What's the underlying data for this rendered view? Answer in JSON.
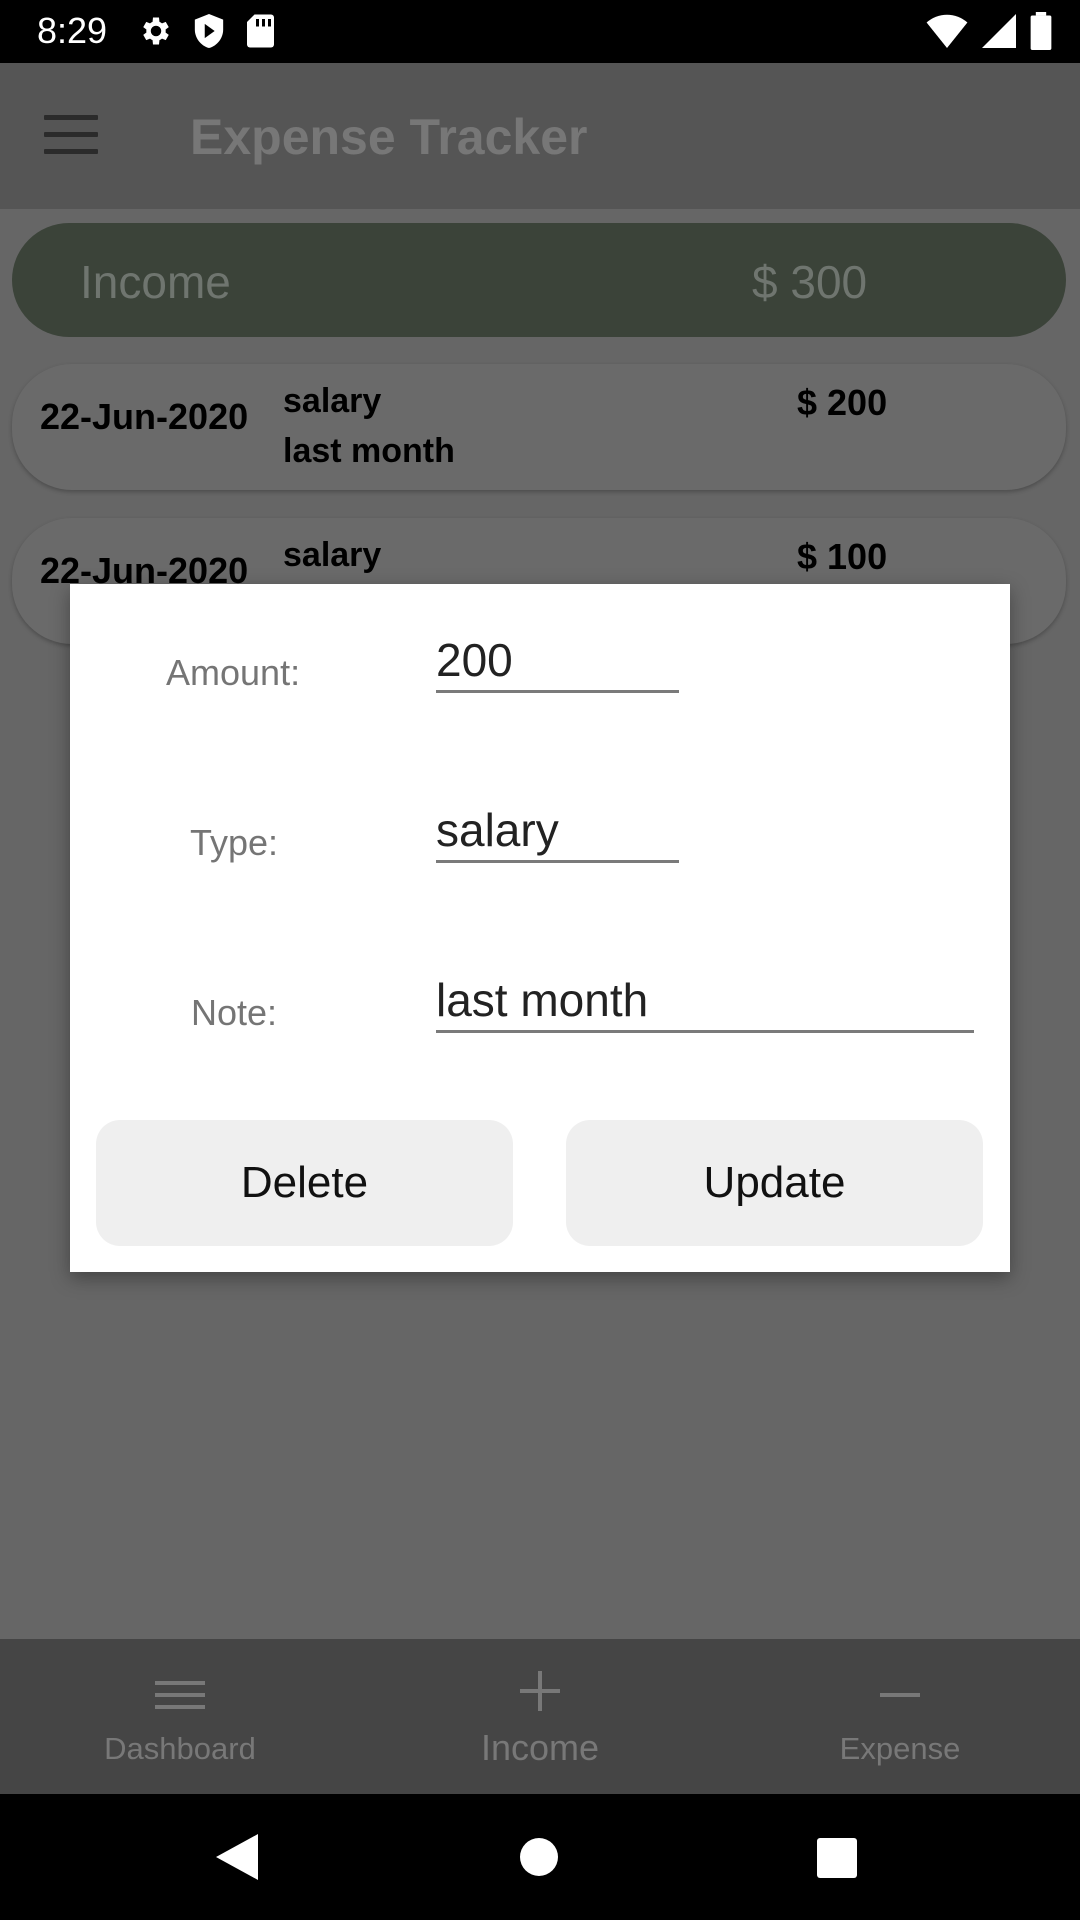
{
  "status_bar": {
    "time": "8:29",
    "left_icons": [
      "gear-icon",
      "shield-icon",
      "sd-card-icon"
    ],
    "right_icons": [
      "wifi-icon",
      "signal-icon",
      "battery-icon"
    ]
  },
  "app_bar": {
    "title": "Expense Tracker",
    "menu_icon": "hamburger-menu-icon"
  },
  "income_header": {
    "label": "Income",
    "value": "$ 300",
    "color": "#3b4339"
  },
  "entries": [
    {
      "date": "22-Jun-2020",
      "type": "salary",
      "note": "last month",
      "amount": "$ 200"
    },
    {
      "date": "22-Jun-2020",
      "type": "salary",
      "note": "",
      "amount": "$ 100"
    }
  ],
  "dialog": {
    "amount_label": "Amount:",
    "amount_value": "200",
    "type_label": "Type:",
    "type_value": "salary",
    "note_label": "Note:",
    "note_value": "last month",
    "delete_label": "Delete",
    "update_label": "Update"
  },
  "bottom_nav": {
    "items": [
      {
        "label": "Dashboard",
        "icon": "list-icon"
      },
      {
        "label": "Income",
        "icon": "plus-icon"
      },
      {
        "label": "Expense",
        "icon": "minus-icon"
      }
    ]
  },
  "system_nav": {
    "icons": [
      "back-icon",
      "home-icon",
      "recents-icon"
    ]
  }
}
